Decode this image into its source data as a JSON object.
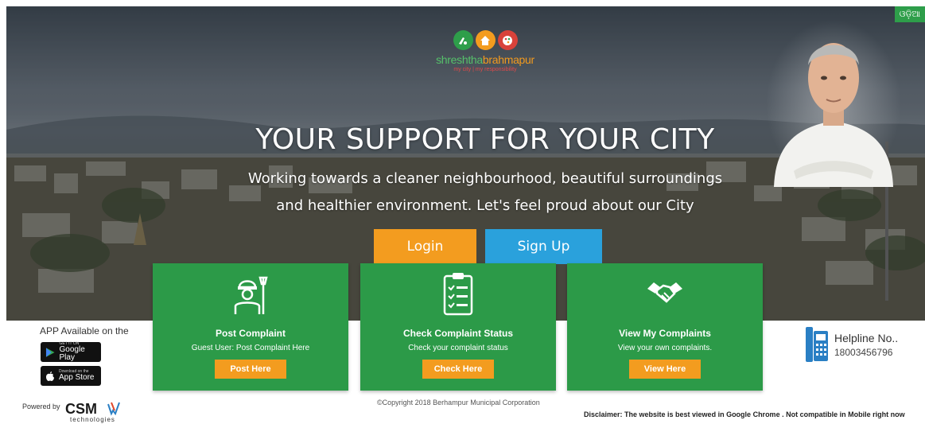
{
  "header": {
    "language_toggle": "ଓଡ଼ିଆ",
    "brand": {
      "name_part1": "shreshtha",
      "name_part2": "brahmapur",
      "tagline": "my city | my responsibility"
    }
  },
  "hero": {
    "headline": "YOUR SUPPORT FOR YOUR CITY",
    "subline_1": "Working towards a cleaner neighbourhood, beautiful surroundings",
    "subline_2": "and healthier environment. Let's feel proud about our City",
    "login_label": "Login",
    "signup_label": "Sign Up"
  },
  "cards": [
    {
      "title": "Post Complaint",
      "desc": "Guest User: Post Complaint Here",
      "button": "Post Here",
      "icon": "worker-icon"
    },
    {
      "title": "Check Complaint Status",
      "desc": "Check your complaint status",
      "button": "Check Here",
      "icon": "clipboard-checklist-icon"
    },
    {
      "title": "View My Complaints",
      "desc": "View your own complaints.",
      "button": "View Here",
      "icon": "handshake-icon"
    }
  ],
  "apps": {
    "label": "APP Available on the",
    "google_play_small": "GET IT ON",
    "google_play": "Google Play",
    "app_store_small": "Download on the",
    "app_store": "App Store"
  },
  "helpline": {
    "label": "Helpline No..",
    "number": "18003456796"
  },
  "footer": {
    "powered_by": "Powered by",
    "company_logo": "CSM",
    "company_logo_sub": "technologies",
    "copyright": "©Copyright 2018 Berhampur Municipal Corporation",
    "disclaimer": "Disclaimer: The website is best viewed in Google Chrome . Not compatible in Mobile right now"
  },
  "colors": {
    "green": "#2c9a48",
    "orange": "#f39c1f",
    "blue": "#2aa1dc"
  }
}
